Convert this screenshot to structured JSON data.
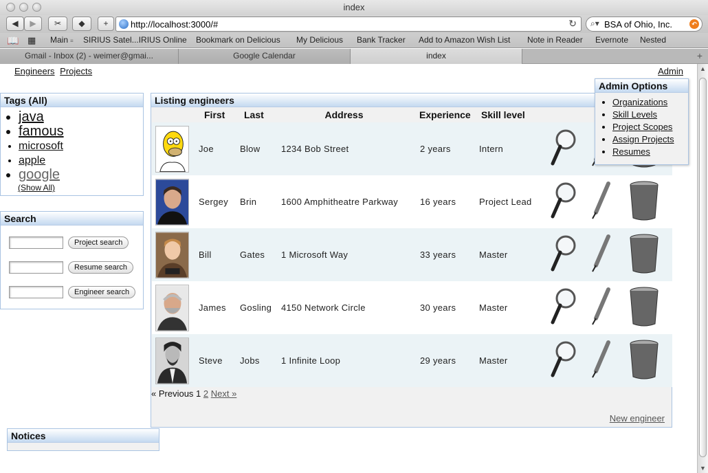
{
  "window": {
    "title": "index"
  },
  "toolbar": {
    "url": "http://localhost:3000/#",
    "search": "BSA of Ohio, Inc.",
    "back_icon": "back-arrow-icon",
    "forward_icon": "forward-arrow-icon"
  },
  "bookmarks": [
    "Main",
    "SIRIUS Satel...IRIUS Online",
    "Bookmark on Delicious",
    "My Delicious",
    "Bank Tracker",
    "Add to Amazon Wish List",
    "Note in Reader",
    "Evernote",
    "Nested"
  ],
  "tabs": [
    {
      "label": "Gmail - Inbox (2) - weimer@gmai..."
    },
    {
      "label": "Google Calendar"
    },
    {
      "label": "index"
    }
  ],
  "nav": {
    "engineers": "Engineers",
    "projects": "Projects",
    "admin": "Admin"
  },
  "tags": {
    "title": "Tags (All)",
    "items": [
      "java",
      "famous",
      "microsoft",
      "apple",
      "google"
    ],
    "show_all": "(Show All)"
  },
  "search": {
    "title": "Search",
    "project_button": "Project search",
    "resume_button": "Resume search",
    "engineer_button": "Engineer search"
  },
  "notices": {
    "title": "Notices"
  },
  "engineers": {
    "title": "Listing engineers",
    "headers": [
      "First",
      "Last",
      "Address",
      "Experience",
      "Skill level"
    ],
    "rows": [
      {
        "first": "Joe",
        "last": "Blow",
        "address": "1234 Bob Street",
        "experience": "2 years",
        "skill": "Intern"
      },
      {
        "first": "Sergey",
        "last": "Brin",
        "address": "1600 Amphitheatre Parkway",
        "experience": "16 years",
        "skill": "Project Lead"
      },
      {
        "first": "Bill",
        "last": "Gates",
        "address": "1 Microsoft Way",
        "experience": "33 years",
        "skill": "Master"
      },
      {
        "first": "James",
        "last": "Gosling",
        "address": "4150 Network Circle",
        "experience": "30 years",
        "skill": "Master"
      },
      {
        "first": "Steve",
        "last": "Jobs",
        "address": "1 Infinite Loop",
        "experience": "29 years",
        "skill": "Master"
      }
    ],
    "pager": {
      "prev": "« Previous",
      "current": "1",
      "page2": "2",
      "next": "Next »"
    },
    "new_link": "New engineer"
  },
  "admin_menu": {
    "title": "Admin Options",
    "items": [
      "Organizations",
      "Skill Levels",
      "Project Scopes",
      "Assign Projects",
      "Resumes"
    ]
  },
  "colors": {
    "panel_border": "#a9c3e2",
    "panel_header": "#c4d9f0",
    "row_alt": "#ebf3f6"
  }
}
